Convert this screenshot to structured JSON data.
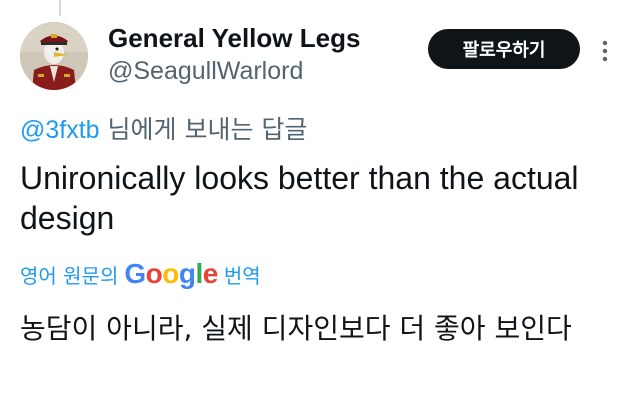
{
  "tweet": {
    "author": {
      "display_name": "General Yellow Legs",
      "handle": "@SeagullWarlord"
    },
    "follow_label": "팔로우하기",
    "more_icon": "more-vertical-icon",
    "reply_to": {
      "mention": "@3fxtb",
      "suffix": " 님에게 보내는 답글"
    },
    "text": "Unironically looks better than the actual design",
    "translation": {
      "prefix": "영어 원문의",
      "provider": "Google",
      "suffix": "번역",
      "text": "농담이 아니라, 실제 디자인보다 더 좋아 보인다"
    }
  },
  "colors": {
    "link_blue": "#1d9bf0",
    "secondary_text": "#536471",
    "follow_button": "#0f1419"
  }
}
